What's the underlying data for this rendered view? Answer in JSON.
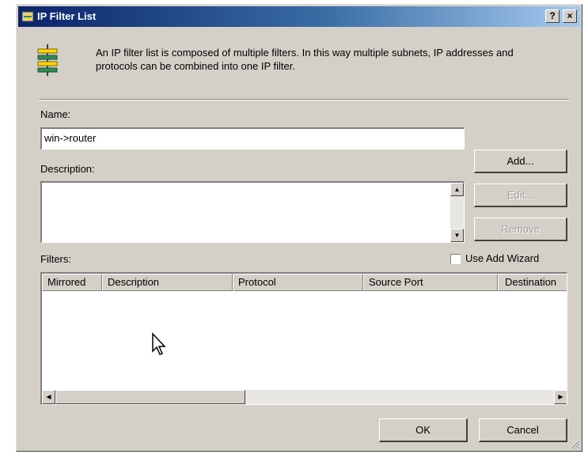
{
  "window": {
    "title": "IP Filter List",
    "help_button": "?",
    "close_button": "×"
  },
  "intro_text": "An IP filter list is composed of multiple filters. In this way multiple subnets, IP addresses and protocols can be combined into one IP filter.",
  "name": {
    "label": "Name:",
    "value": "win->router"
  },
  "description": {
    "label": "Description:",
    "value": ""
  },
  "buttons": {
    "add": "Add...",
    "edit": "Edit...",
    "remove": "Remove",
    "ok": "OK",
    "cancel": "Cancel"
  },
  "filters": {
    "label": "Filters:",
    "use_wizard_label": "Use Add Wizard",
    "use_wizard_checked": false,
    "columns": [
      "Mirrored",
      "Description",
      "Protocol",
      "Source Port",
      "Destination"
    ],
    "rows": []
  },
  "icons": {
    "title_icon": "filter-list-icon",
    "header_icon": "filter-list-icon",
    "pointer": "mouse-pointer-icon"
  },
  "colors": {
    "dialog_face": "#d4d0c8",
    "titlebar_start": "#0a246a",
    "titlebar_end": "#a6caf0",
    "icon_yellow": "#ffd700",
    "icon_green": "#2e8b57"
  }
}
